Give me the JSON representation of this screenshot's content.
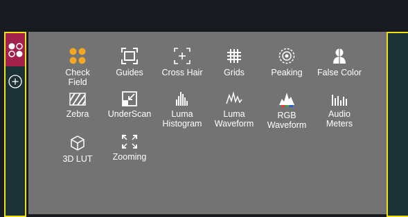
{
  "colors": {
    "accent": "#f0e01a",
    "tile": "#a3224b",
    "orange": "#f4a822",
    "panel": "#737373"
  },
  "sidebar": {
    "apps_icon": "four-circles-icon",
    "add_icon": "plus-circle-icon"
  },
  "tools": {
    "check_field": "Check\nField",
    "guides": "Guides",
    "cross_hair": "Cross Hair",
    "grids": "Grids",
    "peaking": "Peaking",
    "false_color": "False Color",
    "zebra": "Zebra",
    "underscan": "UnderScan",
    "luma_histogram": "Luma\nHistogram",
    "luma_waveform": "Luma\nWaveform",
    "rgb_waveform": "RGB\nWaveform",
    "audio_meters": "Audio\nMeters",
    "lut_3d": "3D LUT",
    "zooming": "Zooming"
  }
}
